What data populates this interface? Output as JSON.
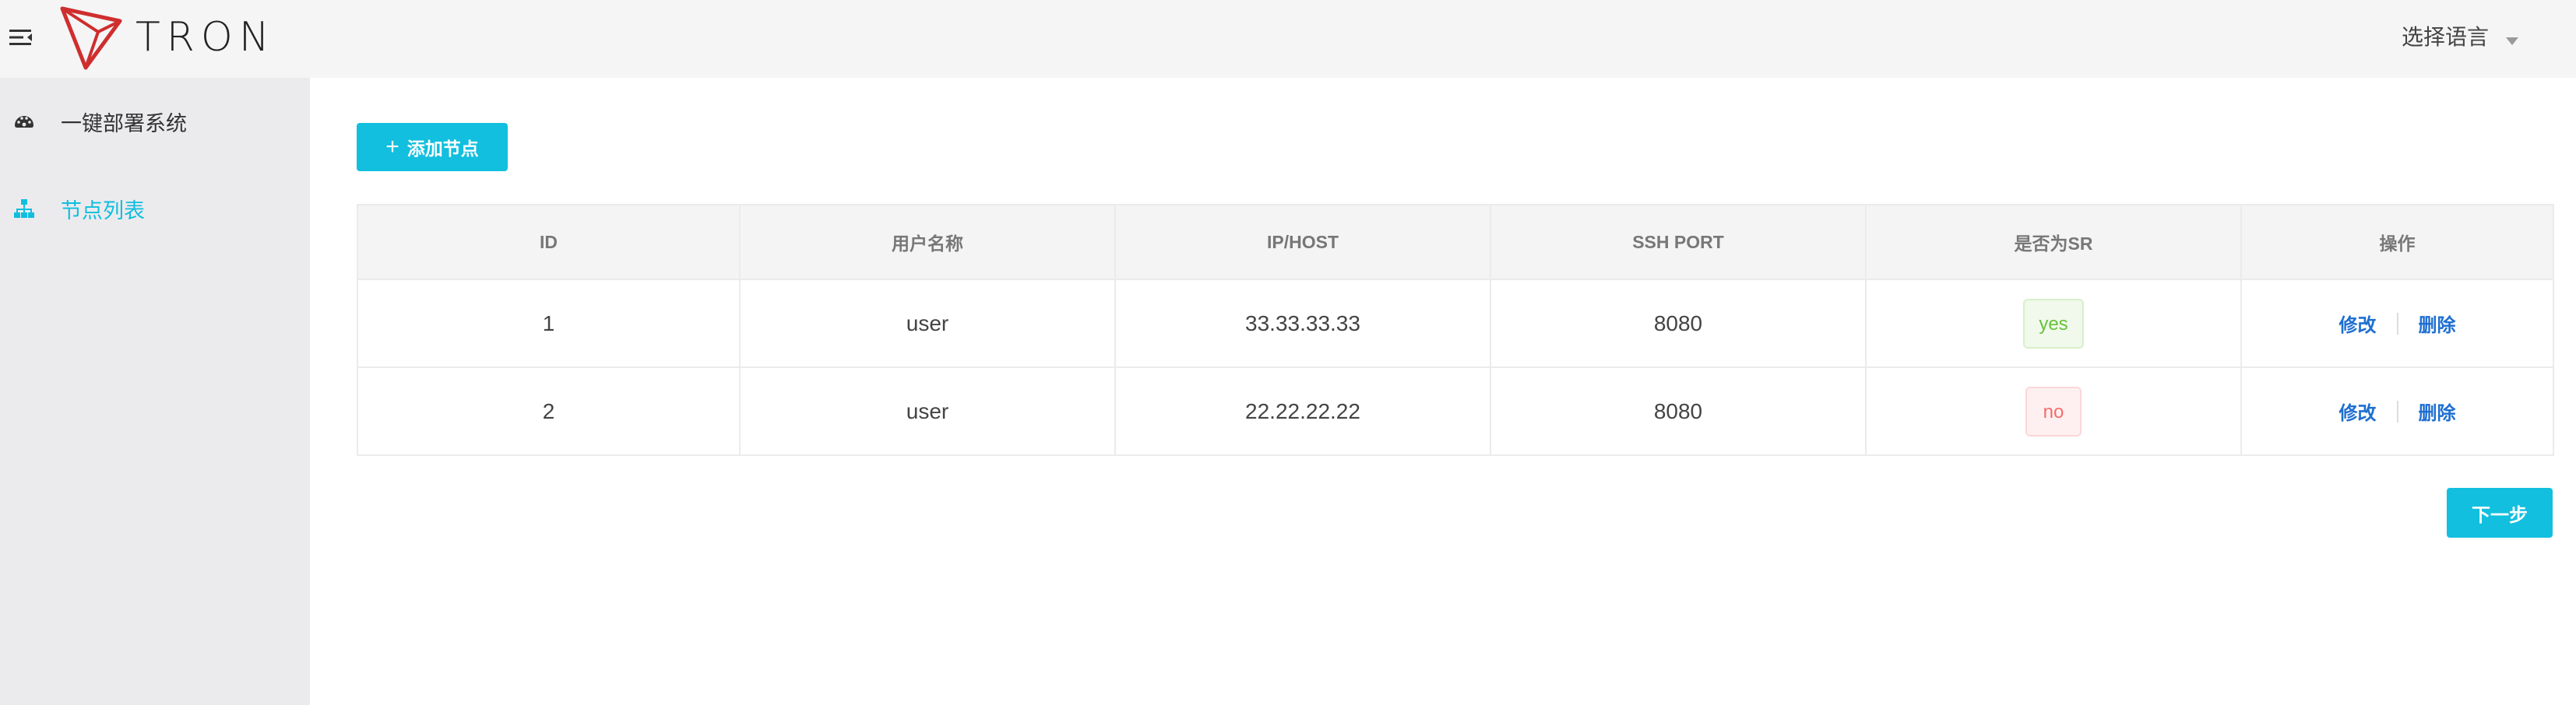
{
  "header": {
    "logo_text": "TRON",
    "language_label": "选择语言",
    "accent_color": "#cf2e2e"
  },
  "sidebar": {
    "items": [
      {
        "label": "一键部署系统",
        "icon": "dashboard-icon",
        "active": false
      },
      {
        "label": "节点列表",
        "icon": "sitemap-icon",
        "active": true
      }
    ],
    "active_color": "#10bedf"
  },
  "main": {
    "add_button_label": "添加节点",
    "next_button_label": "下一步",
    "table": {
      "columns": [
        "ID",
        "用户名称",
        "IP/HOST",
        "SSH PORT",
        "是否为SR",
        "操作"
      ],
      "rows": [
        {
          "id": "1",
          "user": "user",
          "host": "33.33.33.33",
          "port": "8080",
          "sr": "yes",
          "edit": "修改",
          "delete": "删除"
        },
        {
          "id": "2",
          "user": "user",
          "host": "22.22.22.22",
          "port": "8080",
          "sr": "no",
          "edit": "修改",
          "delete": "删除"
        }
      ]
    }
  },
  "colors": {
    "primary": "#12bfdf",
    "link": "#1f6fd0",
    "yes": "#67c23a",
    "no": "#f56c6c"
  }
}
